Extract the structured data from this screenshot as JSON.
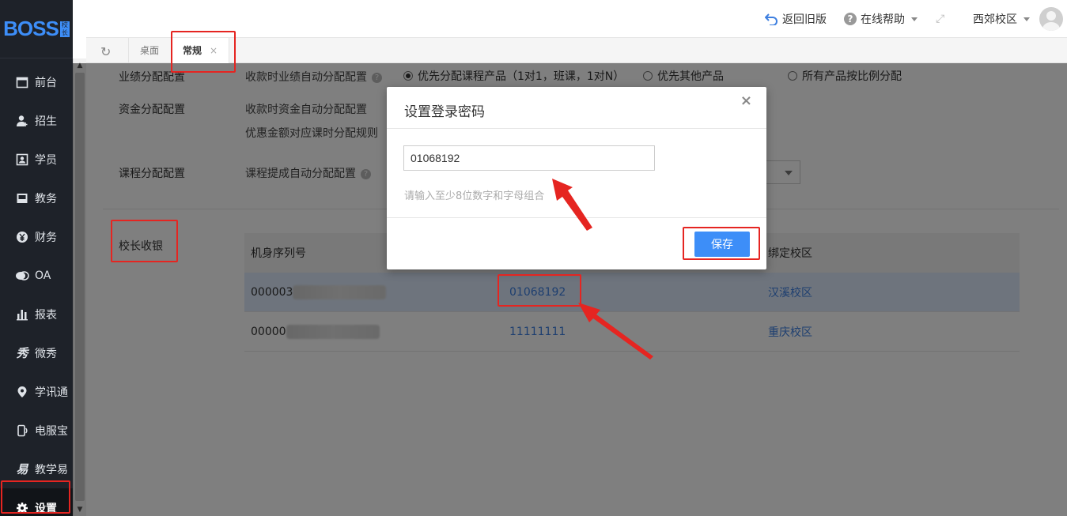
{
  "sidebar": {
    "logo": "BOSS",
    "logo_badge": "校长",
    "items": [
      {
        "label": "前台",
        "icon": "calendar-icon"
      },
      {
        "label": "招生",
        "icon": "user-add-icon"
      },
      {
        "label": "学员",
        "icon": "id-card-icon"
      },
      {
        "label": "教务",
        "icon": "book-icon"
      },
      {
        "label": "财务",
        "icon": "yen-icon"
      },
      {
        "label": "OA",
        "icon": "chat-icon"
      },
      {
        "label": "报表",
        "icon": "bar-chart-icon"
      },
      {
        "label": "微秀",
        "icon": "xiu-icon"
      },
      {
        "label": "学讯通",
        "icon": "location-pin-icon"
      },
      {
        "label": "电服宝",
        "icon": "phone-icon"
      },
      {
        "label": "教学易",
        "icon": "teach-icon"
      },
      {
        "label": "设置",
        "icon": "gear-icon"
      }
    ]
  },
  "header": {
    "back_old": "返回旧版",
    "help": "在线帮助",
    "campus": "西郊校区"
  },
  "tabs": [
    {
      "label": "桌面"
    },
    {
      "label": "常规",
      "close": "×"
    }
  ],
  "settings": {
    "perf_alloc": {
      "section": "业绩分配配置",
      "row": "收款时业绩自动分配配置",
      "opt1": "优先分配课程产品（1对1，班课，1对N）",
      "opt2": "优先其他产品",
      "opt3": "所有产品按比例分配"
    },
    "fund_alloc": {
      "section": "资金分配配置",
      "row1": "收款时资金自动分配配置",
      "row2": "优惠金额对应课时分配规则"
    },
    "course_alloc": {
      "section": "课程分配配置",
      "row": "课程提成自动分配配置"
    },
    "cashier": {
      "section": "校长收银",
      "col_serial": "机身序列号",
      "col_campus": "绑定校区",
      "rows": [
        {
          "serial": "000003",
          "password": "01068192",
          "campus": "汉溪校区"
        },
        {
          "serial": "00000",
          "password": "11111111",
          "campus": "重庆校区"
        }
      ]
    }
  },
  "modal": {
    "title": "设置登录密码",
    "close": "×",
    "input_value": "01068192",
    "hint": "请输入至少8位数字和字母组合",
    "save": "保存"
  }
}
